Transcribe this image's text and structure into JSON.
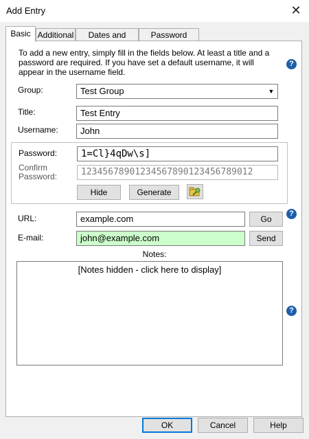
{
  "window": {
    "title": "Add Entry",
    "close_glyph": "✕"
  },
  "tabs": [
    {
      "label": "Basic",
      "active": true
    },
    {
      "label": "Additional",
      "active": false
    },
    {
      "label": "Dates and Times",
      "active": false
    },
    {
      "label": "Password Policy",
      "active": false
    }
  ],
  "intro": "To add a new entry, simply fill in the fields below. At least a title and a password are required. If you have set a default username, it will appear in the username field.",
  "help_glyph": "?",
  "fields": {
    "group_label": "Group:",
    "group_value": "Test Group",
    "title_label": "Title:",
    "title_value": "Test Entry",
    "username_label": "Username:",
    "username_value": "John",
    "password_label": "Password:",
    "password_value": "1=Cl}4qDw\\s]",
    "confirm_label": "Confirm Password:",
    "confirm_value": "12345678901234567890123456789012",
    "url_label": "URL:",
    "url_value": "example.com",
    "email_label": "E-mail:",
    "email_value": "john@example.com",
    "notes_label": "Notes:",
    "notes_value": "[Notes hidden - click here to display]"
  },
  "buttons": {
    "hide": "Hide",
    "generate": "Generate",
    "go": "Go",
    "send": "Send",
    "ok": "OK",
    "cancel": "Cancel",
    "help": "Help"
  },
  "icons": {
    "help": "help-question-icon",
    "password_gen": "key-folder-icon",
    "dropdown": "chevron-down-icon"
  },
  "colors": {
    "email_bg": "#ccffcc",
    "help_icon": "#1f5fa9",
    "default_button_border": "#0078d7"
  }
}
